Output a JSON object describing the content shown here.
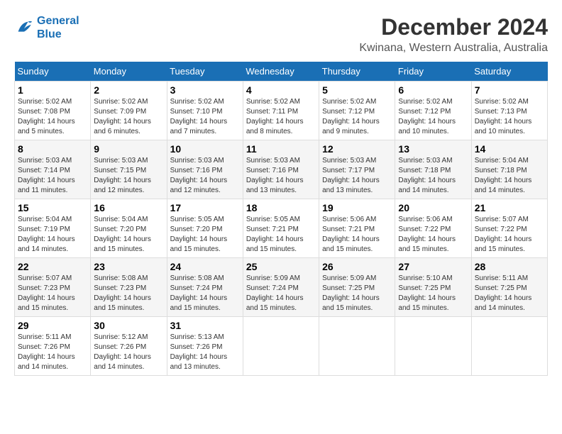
{
  "logo": {
    "line1": "General",
    "line2": "Blue"
  },
  "title": "December 2024",
  "location": "Kwinana, Western Australia, Australia",
  "headers": [
    "Sunday",
    "Monday",
    "Tuesday",
    "Wednesday",
    "Thursday",
    "Friday",
    "Saturday"
  ],
  "weeks": [
    [
      {
        "day": "1",
        "info": "Sunrise: 5:02 AM\nSunset: 7:08 PM\nDaylight: 14 hours\nand 5 minutes."
      },
      {
        "day": "2",
        "info": "Sunrise: 5:02 AM\nSunset: 7:09 PM\nDaylight: 14 hours\nand 6 minutes."
      },
      {
        "day": "3",
        "info": "Sunrise: 5:02 AM\nSunset: 7:10 PM\nDaylight: 14 hours\nand 7 minutes."
      },
      {
        "day": "4",
        "info": "Sunrise: 5:02 AM\nSunset: 7:11 PM\nDaylight: 14 hours\nand 8 minutes."
      },
      {
        "day": "5",
        "info": "Sunrise: 5:02 AM\nSunset: 7:12 PM\nDaylight: 14 hours\nand 9 minutes."
      },
      {
        "day": "6",
        "info": "Sunrise: 5:02 AM\nSunset: 7:12 PM\nDaylight: 14 hours\nand 10 minutes."
      },
      {
        "day": "7",
        "info": "Sunrise: 5:02 AM\nSunset: 7:13 PM\nDaylight: 14 hours\nand 10 minutes."
      }
    ],
    [
      {
        "day": "8",
        "info": "Sunrise: 5:03 AM\nSunset: 7:14 PM\nDaylight: 14 hours\nand 11 minutes."
      },
      {
        "day": "9",
        "info": "Sunrise: 5:03 AM\nSunset: 7:15 PM\nDaylight: 14 hours\nand 12 minutes."
      },
      {
        "day": "10",
        "info": "Sunrise: 5:03 AM\nSunset: 7:16 PM\nDaylight: 14 hours\nand 12 minutes."
      },
      {
        "day": "11",
        "info": "Sunrise: 5:03 AM\nSunset: 7:16 PM\nDaylight: 14 hours\nand 13 minutes."
      },
      {
        "day": "12",
        "info": "Sunrise: 5:03 AM\nSunset: 7:17 PM\nDaylight: 14 hours\nand 13 minutes."
      },
      {
        "day": "13",
        "info": "Sunrise: 5:03 AM\nSunset: 7:18 PM\nDaylight: 14 hours\nand 14 minutes."
      },
      {
        "day": "14",
        "info": "Sunrise: 5:04 AM\nSunset: 7:18 PM\nDaylight: 14 hours\nand 14 minutes."
      }
    ],
    [
      {
        "day": "15",
        "info": "Sunrise: 5:04 AM\nSunset: 7:19 PM\nDaylight: 14 hours\nand 14 minutes."
      },
      {
        "day": "16",
        "info": "Sunrise: 5:04 AM\nSunset: 7:20 PM\nDaylight: 14 hours\nand 15 minutes."
      },
      {
        "day": "17",
        "info": "Sunrise: 5:05 AM\nSunset: 7:20 PM\nDaylight: 14 hours\nand 15 minutes."
      },
      {
        "day": "18",
        "info": "Sunrise: 5:05 AM\nSunset: 7:21 PM\nDaylight: 14 hours\nand 15 minutes."
      },
      {
        "day": "19",
        "info": "Sunrise: 5:06 AM\nSunset: 7:21 PM\nDaylight: 14 hours\nand 15 minutes."
      },
      {
        "day": "20",
        "info": "Sunrise: 5:06 AM\nSunset: 7:22 PM\nDaylight: 14 hours\nand 15 minutes."
      },
      {
        "day": "21",
        "info": "Sunrise: 5:07 AM\nSunset: 7:22 PM\nDaylight: 14 hours\nand 15 minutes."
      }
    ],
    [
      {
        "day": "22",
        "info": "Sunrise: 5:07 AM\nSunset: 7:23 PM\nDaylight: 14 hours\nand 15 minutes."
      },
      {
        "day": "23",
        "info": "Sunrise: 5:08 AM\nSunset: 7:23 PM\nDaylight: 14 hours\nand 15 minutes."
      },
      {
        "day": "24",
        "info": "Sunrise: 5:08 AM\nSunset: 7:24 PM\nDaylight: 14 hours\nand 15 minutes."
      },
      {
        "day": "25",
        "info": "Sunrise: 5:09 AM\nSunset: 7:24 PM\nDaylight: 14 hours\nand 15 minutes."
      },
      {
        "day": "26",
        "info": "Sunrise: 5:09 AM\nSunset: 7:25 PM\nDaylight: 14 hours\nand 15 minutes."
      },
      {
        "day": "27",
        "info": "Sunrise: 5:10 AM\nSunset: 7:25 PM\nDaylight: 14 hours\nand 15 minutes."
      },
      {
        "day": "28",
        "info": "Sunrise: 5:11 AM\nSunset: 7:25 PM\nDaylight: 14 hours\nand 14 minutes."
      }
    ],
    [
      {
        "day": "29",
        "info": "Sunrise: 5:11 AM\nSunset: 7:26 PM\nDaylight: 14 hours\nand 14 minutes."
      },
      {
        "day": "30",
        "info": "Sunrise: 5:12 AM\nSunset: 7:26 PM\nDaylight: 14 hours\nand 14 minutes."
      },
      {
        "day": "31",
        "info": "Sunrise: 5:13 AM\nSunset: 7:26 PM\nDaylight: 14 hours\nand 13 minutes."
      },
      {
        "day": "",
        "info": ""
      },
      {
        "day": "",
        "info": ""
      },
      {
        "day": "",
        "info": ""
      },
      {
        "day": "",
        "info": ""
      }
    ]
  ]
}
